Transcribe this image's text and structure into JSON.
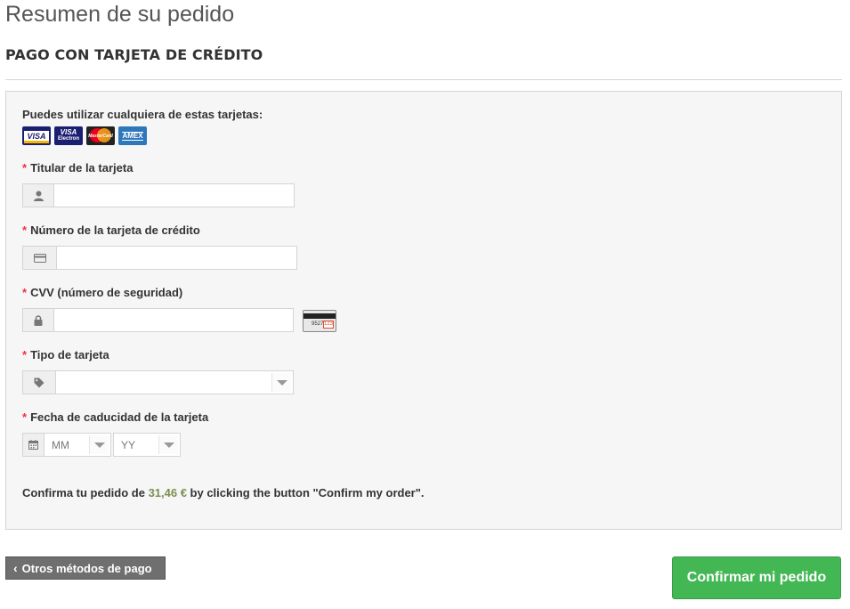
{
  "page": {
    "title": "Resumen de su pedido",
    "subtitle": "PAGO CON TARJETA DE CRÉDITO"
  },
  "cards": {
    "intro": "Puedes utilizar cualquiera de estas tarjetas:",
    "logos": [
      {
        "name": "visa",
        "text": "VISA"
      },
      {
        "name": "visa-electron",
        "text": "VISA",
        "subtext": "Electron"
      },
      {
        "name": "mastercard",
        "text": "MasterCard"
      },
      {
        "name": "amex",
        "text": "AMEX"
      }
    ]
  },
  "form": {
    "required_mark": "*",
    "holder": {
      "label": "Titular de la tarjeta",
      "value": "",
      "icon": "user-icon"
    },
    "number": {
      "label": "Número de la tarjeta de crédito",
      "value": "",
      "icon": "credit-card-icon"
    },
    "cvv": {
      "label": "CVV (número de seguridad)",
      "value": "",
      "icon": "lock-icon",
      "hint_digits": "9527",
      "hint_code": "123"
    },
    "type": {
      "label": "Tipo de tarjeta",
      "value": "",
      "icon": "tag-icon"
    },
    "expiry": {
      "label": "Fecha de caducidad de la tarjeta",
      "icon": "calendar-icon",
      "month_placeholder": "MM",
      "year_placeholder": "YY"
    }
  },
  "confirm": {
    "prefix": "Confirma tu pedido de ",
    "amount": "31,46 €",
    "suffix": " by clicking the button \"Confirm my order\"."
  },
  "buttons": {
    "back": "Otros métodos de pago",
    "confirm": "Confirmar mi pedido"
  },
  "colors": {
    "confirm_button": "#43b754",
    "back_button": "#6f6f6f",
    "required": "#f13340",
    "price": "#7b8f52"
  }
}
